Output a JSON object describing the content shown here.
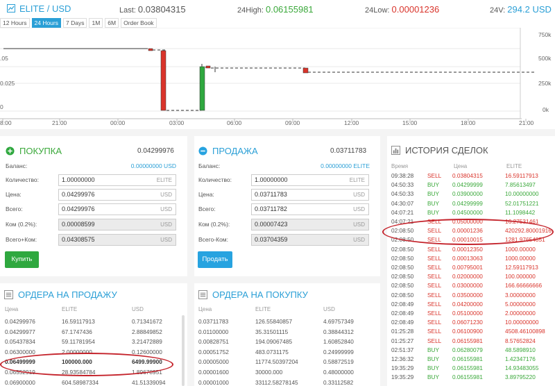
{
  "header": {
    "pair": "ELITE / USD",
    "last_label": "Last:",
    "last_value": "0.03804315",
    "high_label": "24High:",
    "high_value": "0.06155981",
    "low_label": "24Low:",
    "low_value": "0.00001236",
    "vol_label": "24V:",
    "vol_value": "294.2 USD"
  },
  "tabs": [
    "12 Hours",
    "24 Hours",
    "7 Days",
    "1M",
    "6M",
    "Order Book"
  ],
  "active_tab": "24 Hours",
  "chart": {
    "y_left_ticks": [
      ".05",
      "0.025",
      "0"
    ],
    "y_right_ticks": [
      "750k",
      "500k",
      "250k",
      "0k"
    ],
    "x_ticks": [
      "8:00",
      "21:00",
      "00:00",
      "03:00",
      "06:00",
      "09:00",
      "12:00",
      "15:00",
      "18:00",
      "21:00"
    ],
    "colors": {
      "up": "#2fa83f",
      "down": "#d9342b",
      "grid": "#e6e6e6"
    }
  },
  "buy": {
    "title": "ПОКУПКА",
    "price": "0.04299976",
    "balance_label": "Баланс:",
    "balance_value": "0.00000000 USD",
    "qty_label": "Количество:",
    "qty_value": "1.00000000",
    "qty_unit": "ELITE",
    "price_label": "Цена:",
    "price_value": "0.04299976",
    "price_unit": "USD",
    "total_label": "Всего:",
    "total_value": "0.04299976",
    "total_unit": "USD",
    "fee_label": "Ком (0.2%):",
    "fee_value": "0.00008599",
    "fee_unit": "USD",
    "totalfee_label": "Всего+Ком:",
    "totalfee_value": "0.04308575",
    "totalfee_unit": "USD",
    "button": "Купить"
  },
  "sell": {
    "title": "ПРОДАЖА",
    "price": "0.03711783",
    "balance_label": "Баланс:",
    "balance_value": "0.00000000 ELITE",
    "qty_label": "Количество:",
    "qty_value": "1.00000000",
    "qty_unit": "ELITE",
    "price_label": "Цена:",
    "price_value": "0.03711783",
    "price_unit": "USD",
    "total_label": "Всего:",
    "total_value": "0.03711782",
    "total_unit": "USD",
    "fee_label": "Ком (0.2%):",
    "fee_value": "0.00007423",
    "fee_unit": "USD",
    "totalfee_label": "Всего-Ком:",
    "totalfee_value": "0.03704359",
    "totalfee_unit": "USD",
    "button": "Продать"
  },
  "history": {
    "title": "ИСТОРИЯ СДЕЛОК",
    "headers": [
      "Время",
      "",
      "Цена",
      "ELITE"
    ],
    "rows": [
      [
        "09:38:28",
        "SELL",
        "0.03804315",
        "16.59117913"
      ],
      [
        "04:50:33",
        "BUY",
        "0.04299999",
        "7.85613497"
      ],
      [
        "04:50:33",
        "BUY",
        "0.03900000",
        "10.00000000"
      ],
      [
        "04:30:07",
        "BUY",
        "0.04299999",
        "52.01751221"
      ],
      [
        "04:07:21",
        "BUY",
        "0.04500000",
        "11.1098442"
      ],
      [
        "04:07:21",
        "SELL",
        "0.05000000",
        "16.27531461"
      ],
      [
        "02:08:50",
        "SELL",
        "0.00001236",
        "420292.80001916"
      ],
      [
        "02:08:50",
        "SELL",
        "0.00010015",
        "1281.97654851"
      ],
      [
        "02:08:50",
        "SELL",
        "0.00012350",
        "1000.00000"
      ],
      [
        "02:08:50",
        "SELL",
        "0.00013063",
        "1000.00000"
      ],
      [
        "02:08:50",
        "SELL",
        "0.00795001",
        "12.59117913"
      ],
      [
        "02:08:50",
        "SELL",
        "0.02000000",
        "100.000000"
      ],
      [
        "02:08:50",
        "SELL",
        "0.03000000",
        "166.66666666"
      ],
      [
        "02:08:50",
        "SELL",
        "0.03500000",
        "3.00000000"
      ],
      [
        "02:08:49",
        "SELL",
        "0.04200000",
        "5.00000000"
      ],
      [
        "02:08:49",
        "SELL",
        "0.05100000",
        "2.00000000"
      ],
      [
        "02:08:49",
        "SELL",
        "0.06071230",
        "10.00000000"
      ],
      [
        "01:25:28",
        "SELL",
        "0.06100900",
        "4508.46100898"
      ],
      [
        "01:25:27",
        "SELL",
        "0.06155981",
        "8.57652824"
      ],
      [
        "02:51:37",
        "BUY",
        "0.06280079",
        "48.5898910"
      ],
      [
        "12:36:32",
        "BUY",
        "0.06155981",
        "1.42347176"
      ],
      [
        "19:35:29",
        "BUY",
        "0.06155981",
        "14.93483055"
      ],
      [
        "19:35:29",
        "BUY",
        "0.06155981",
        "3.89795220"
      ]
    ]
  },
  "asks": {
    "title": "ОРДЕРА НА ПРОДАЖУ",
    "headers": [
      "Цена",
      "ELITE",
      "USD"
    ],
    "rows": [
      [
        "0.04299976",
        "16.59117913",
        "0.71341672"
      ],
      [
        "0.04299977",
        "67.1747436",
        "2.88849852"
      ],
      [
        "0.05437834",
        "59.11781954",
        "3.21472889"
      ],
      [
        "0.06300000",
        "2.00000000",
        "0.12600000"
      ],
      [
        "0.06499999",
        "100000.000",
        "6499.99900"
      ],
      [
        "0.06552919",
        "28.93584784",
        "1.89678951"
      ],
      [
        "0.06900000",
        "604.58987334",
        "41.51339094"
      ]
    ]
  },
  "bids": {
    "title": "ОРДЕРА НА ПОКУПКУ",
    "headers": [
      "Цена",
      "ELITE",
      "USD"
    ],
    "rows": [
      [
        "0.03711783",
        "126.55840857",
        "4.69757349"
      ],
      [
        "0.01100000",
        "35.31501115",
        "0.38844312"
      ],
      [
        "0.00828751",
        "194.09067485",
        "1.60852840"
      ],
      [
        "0.00051752",
        "483.0731175",
        "0.24999999"
      ],
      [
        "0.00005000",
        "11774.50397204",
        "0.58872519"
      ],
      [
        "0.00001600",
        "30000.000",
        "0.48000000"
      ],
      [
        "0.00001000",
        "33112.58278145",
        "0.33112582"
      ]
    ]
  }
}
